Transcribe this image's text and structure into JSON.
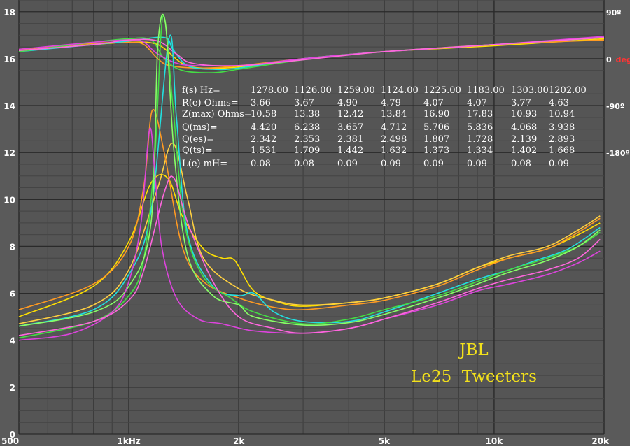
{
  "chart_data": {
    "type": "line",
    "x_scale": "log",
    "xlim": [
      500,
      20000
    ],
    "ylim": [
      0,
      18.5
    ],
    "grid": true,
    "left_ticks": [
      {
        "value": 0,
        "label": "0"
      },
      {
        "value": 2,
        "label": "2"
      },
      {
        "value": 4,
        "label": "4"
      },
      {
        "value": 6,
        "label": "6"
      },
      {
        "value": 8,
        "label": "8"
      },
      {
        "value": 10,
        "label": "10"
      },
      {
        "value": 12,
        "label": "12"
      },
      {
        "value": 14,
        "label": "14"
      },
      {
        "value": 16,
        "label": "16"
      },
      {
        "value": 18,
        "label": "18"
      }
    ],
    "x_tick_labels": [
      {
        "value": 500,
        "label": "500"
      },
      {
        "value": 1000,
        "label": "1kHz"
      },
      {
        "value": 2000,
        "label": "2k"
      },
      {
        "value": 5000,
        "label": "5k"
      },
      {
        "value": 10000,
        "label": "10k"
      },
      {
        "value": 20000,
        "label": "20k"
      }
    ],
    "phase_ticks": [
      {
        "value": 18,
        "label": "90º",
        "accent": ""
      },
      {
        "value": 16,
        "label": "0",
        "accent": "deg"
      },
      {
        "value": 14,
        "label": "-90º",
        "accent": ""
      },
      {
        "value": 12,
        "label": "-180º",
        "accent": ""
      }
    ],
    "params": {
      "labels": [
        "f(s) Hz=",
        "R(e) Ohms=",
        "Z(max) Ohms=",
        "Q(ms)=",
        "Q(es)=",
        "Q(ts)=",
        "L(e) mH="
      ],
      "columns": [
        [
          "1278.00",
          "3.66",
          "10.58",
          "4.420",
          "2.342",
          "1.531",
          "0.08"
        ],
        [
          "1126.00",
          "3.67",
          "13.38",
          "6.238",
          "2.353",
          "1.709",
          "0.08"
        ],
        [
          "1259.00",
          "4.90",
          "12.42",
          "3.657",
          "2.381",
          "1.442",
          "0.09"
        ],
        [
          "1124.00",
          "4.79",
          "13.84",
          "4.712",
          "2.498",
          "1.632",
          "0.09"
        ],
        [
          "1225.00",
          "4.07",
          "16.90",
          "5.706",
          "1.807",
          "1.373",
          "0.09"
        ],
        [
          "1183.00",
          "4.07",
          "17.83",
          "5.836",
          "1.728",
          "1.334",
          "0.09"
        ],
        [
          "1303.00",
          "3.77",
          "10.93",
          "4.068",
          "2.139",
          "1.402",
          "0.08"
        ],
        [
          "1202.00",
          "4.63",
          "10.94",
          "3.938",
          "2.893",
          "1.668",
          "0.09"
        ]
      ]
    },
    "annotations": [
      "JBL",
      "Le25  Tweeters"
    ],
    "impedance_series": [
      {
        "color": "#ffe000",
        "points": [
          [
            500,
            5.0
          ],
          [
            800,
            6.3
          ],
          [
            1000,
            8.2
          ],
          [
            1150,
            10.7
          ],
          [
            1280,
            10.9
          ],
          [
            1400,
            9.3
          ],
          [
            1600,
            7.9
          ],
          [
            1800,
            7.5
          ],
          [
            1950,
            7.4
          ],
          [
            2200,
            6.1
          ],
          [
            2600,
            5.6
          ],
          [
            3000,
            5.45
          ],
          [
            4000,
            5.6
          ],
          [
            5000,
            5.8
          ],
          [
            7000,
            6.4
          ],
          [
            9000,
            7.1
          ],
          [
            11000,
            7.5
          ],
          [
            14000,
            7.9
          ],
          [
            17000,
            8.5
          ],
          [
            19500,
            9.0
          ]
        ]
      },
      {
        "color": "#ffd040",
        "points": [
          [
            500,
            4.7
          ],
          [
            800,
            5.5
          ],
          [
            1000,
            7.0
          ],
          [
            1200,
            10.5
          ],
          [
            1320,
            12.4
          ],
          [
            1450,
            10.0
          ],
          [
            1600,
            7.5
          ],
          [
            2000,
            6.2
          ],
          [
            2500,
            5.7
          ],
          [
            3000,
            5.5
          ],
          [
            4000,
            5.6
          ],
          [
            5000,
            5.8
          ],
          [
            7000,
            6.4
          ],
          [
            9000,
            7.1
          ],
          [
            11000,
            7.6
          ],
          [
            14000,
            8.0
          ],
          [
            17000,
            8.7
          ],
          [
            19500,
            9.3
          ]
        ]
      },
      {
        "color": "#ff9a22",
        "points": [
          [
            500,
            5.3
          ],
          [
            800,
            6.4
          ],
          [
            1000,
            8.0
          ],
          [
            1100,
            10.6
          ],
          [
            1160,
            13.8
          ],
          [
            1250,
            12.0
          ],
          [
            1400,
            8.0
          ],
          [
            1600,
            6.5
          ],
          [
            2000,
            5.8
          ],
          [
            2500,
            5.4
          ],
          [
            3000,
            5.3
          ],
          [
            4000,
            5.5
          ],
          [
            5000,
            5.7
          ],
          [
            7000,
            6.3
          ],
          [
            9000,
            7.0
          ],
          [
            11000,
            7.5
          ],
          [
            14000,
            7.9
          ],
          [
            17000,
            8.6
          ],
          [
            19500,
            9.2
          ]
        ]
      },
      {
        "color": "#22e0e0",
        "points": [
          [
            500,
            4.6
          ],
          [
            800,
            5.3
          ],
          [
            1000,
            6.8
          ],
          [
            1150,
            9.5
          ],
          [
            1290,
            16.9
          ],
          [
            1350,
            13.5
          ],
          [
            1450,
            8.5
          ],
          [
            1700,
            6.3
          ],
          [
            2000,
            5.9
          ],
          [
            2200,
            6.0
          ],
          [
            2500,
            5.2
          ],
          [
            3000,
            4.8
          ],
          [
            4000,
            4.8
          ],
          [
            5000,
            5.2
          ],
          [
            7000,
            6.0
          ],
          [
            9000,
            6.6
          ],
          [
            11000,
            7.0
          ],
          [
            13000,
            7.4
          ],
          [
            16000,
            7.9
          ],
          [
            19500,
            8.8
          ]
        ]
      },
      {
        "color": "#44dd44",
        "points": [
          [
            500,
            4.1
          ],
          [
            800,
            4.8
          ],
          [
            1000,
            5.9
          ],
          [
            1100,
            7.5
          ],
          [
            1180,
            12.0
          ],
          [
            1240,
            17.8
          ],
          [
            1320,
            14.0
          ],
          [
            1420,
            9.0
          ],
          [
            1600,
            6.7
          ],
          [
            1900,
            5.8
          ],
          [
            2200,
            5.2
          ],
          [
            3000,
            4.7
          ],
          [
            4000,
            4.9
          ],
          [
            5000,
            5.3
          ],
          [
            7000,
            5.9
          ],
          [
            9000,
            6.5
          ],
          [
            11000,
            7.0
          ],
          [
            14000,
            7.5
          ],
          [
            17000,
            8.0
          ],
          [
            19500,
            8.6
          ]
        ]
      },
      {
        "color": "#88ff66",
        "points": [
          [
            500,
            4.6
          ],
          [
            800,
            5.2
          ],
          [
            1000,
            6.3
          ],
          [
            1150,
            9.0
          ],
          [
            1200,
            16.5
          ],
          [
            1260,
            17.5
          ],
          [
            1330,
            12.0
          ],
          [
            1450,
            7.6
          ],
          [
            1700,
            5.9
          ],
          [
            2000,
            5.5
          ],
          [
            2200,
            5.0
          ],
          [
            3000,
            4.65
          ],
          [
            4000,
            4.75
          ],
          [
            5000,
            5.1
          ],
          [
            7000,
            5.8
          ],
          [
            9000,
            6.4
          ],
          [
            11000,
            6.9
          ],
          [
            14000,
            7.4
          ],
          [
            17000,
            8.0
          ],
          [
            19500,
            8.7
          ]
        ]
      },
      {
        "color": "#dd44dd",
        "points": [
          [
            500,
            4.0
          ],
          [
            700,
            4.3
          ],
          [
            900,
            5.2
          ],
          [
            1000,
            6.5
          ],
          [
            1080,
            9.0
          ],
          [
            1140,
            13.0
          ],
          [
            1180,
            11.0
          ],
          [
            1230,
            8.0
          ],
          [
            1350,
            5.8
          ],
          [
            1550,
            4.9
          ],
          [
            1800,
            4.7
          ],
          [
            2200,
            4.4
          ],
          [
            3000,
            4.3
          ],
          [
            4000,
            4.5
          ],
          [
            5000,
            4.9
          ],
          [
            7000,
            5.5
          ],
          [
            9000,
            6.1
          ],
          [
            11000,
            6.4
          ],
          [
            14000,
            6.8
          ],
          [
            17000,
            7.3
          ],
          [
            19500,
            7.8
          ]
        ]
      },
      {
        "color": "#ff66dd",
        "points": [
          [
            500,
            4.2
          ],
          [
            800,
            4.8
          ],
          [
            1000,
            5.7
          ],
          [
            1100,
            7.0
          ],
          [
            1250,
            10.3
          ],
          [
            1330,
            10.9
          ],
          [
            1450,
            9.0
          ],
          [
            1700,
            6.5
          ],
          [
            2000,
            5.0
          ],
          [
            2500,
            4.5
          ],
          [
            3000,
            4.3
          ],
          [
            4000,
            4.5
          ],
          [
            5000,
            4.9
          ],
          [
            7000,
            5.6
          ],
          [
            9000,
            6.2
          ],
          [
            11000,
            6.6
          ],
          [
            14000,
            7.0
          ],
          [
            17000,
            7.5
          ],
          [
            19500,
            8.3
          ]
        ]
      }
    ],
    "phase_series": [
      {
        "color": "#ffe000",
        "points": [
          [
            500,
            16.35
          ],
          [
            800,
            16.6
          ],
          [
            1000,
            16.7
          ],
          [
            1200,
            16.6
          ],
          [
            1400,
            15.8
          ],
          [
            1600,
            15.6
          ],
          [
            2000,
            15.65
          ],
          [
            3000,
            16.0
          ],
          [
            5000,
            16.3
          ],
          [
            10000,
            16.55
          ],
          [
            20000,
            16.85
          ]
        ]
      },
      {
        "color": "#ff9a22",
        "points": [
          [
            500,
            16.4
          ],
          [
            800,
            16.65
          ],
          [
            1000,
            16.7
          ],
          [
            1100,
            16.6
          ],
          [
            1200,
            16.0
          ],
          [
            1300,
            15.7
          ],
          [
            1600,
            15.6
          ],
          [
            2000,
            15.7
          ],
          [
            3000,
            16.0
          ],
          [
            5000,
            16.3
          ],
          [
            10000,
            16.6
          ],
          [
            20000,
            16.8
          ]
        ]
      },
      {
        "color": "#22e0e0",
        "points": [
          [
            500,
            16.3
          ],
          [
            800,
            16.6
          ],
          [
            1000,
            16.75
          ],
          [
            1250,
            16.9
          ],
          [
            1320,
            16.4
          ],
          [
            1450,
            15.7
          ],
          [
            1700,
            15.55
          ],
          [
            2000,
            15.6
          ],
          [
            3000,
            16.0
          ],
          [
            5000,
            16.3
          ],
          [
            10000,
            16.6
          ],
          [
            20000,
            16.9
          ]
        ]
      },
      {
        "color": "#44dd44",
        "points": [
          [
            500,
            16.3
          ],
          [
            800,
            16.7
          ],
          [
            1000,
            16.85
          ],
          [
            1150,
            16.8
          ],
          [
            1250,
            16.0
          ],
          [
            1400,
            15.5
          ],
          [
            1700,
            15.4
          ],
          [
            2000,
            15.55
          ],
          [
            3000,
            15.95
          ],
          [
            5000,
            16.3
          ],
          [
            10000,
            16.6
          ],
          [
            20000,
            16.9
          ]
        ]
      },
      {
        "color": "#dd44dd",
        "points": [
          [
            500,
            16.4
          ],
          [
            800,
            16.7
          ],
          [
            1000,
            16.8
          ],
          [
            1100,
            16.7
          ],
          [
            1200,
            16.2
          ],
          [
            1400,
            15.75
          ],
          [
            1800,
            15.7
          ],
          [
            2200,
            15.75
          ],
          [
            3000,
            16.0
          ],
          [
            5000,
            16.3
          ],
          [
            10000,
            16.6
          ],
          [
            20000,
            16.95
          ]
        ]
      },
      {
        "color": "#ff66dd",
        "points": [
          [
            500,
            16.35
          ],
          [
            800,
            16.6
          ],
          [
            1000,
            16.8
          ],
          [
            1200,
            16.75
          ],
          [
            1350,
            16.2
          ],
          [
            1500,
            15.8
          ],
          [
            2000,
            15.7
          ],
          [
            3000,
            15.95
          ],
          [
            5000,
            16.3
          ],
          [
            10000,
            16.6
          ],
          [
            20000,
            16.9
          ]
        ]
      }
    ]
  }
}
